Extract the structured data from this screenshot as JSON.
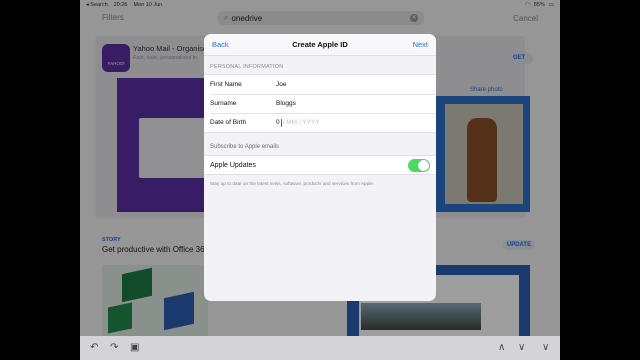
{
  "status": {
    "carrier": "◂ Search",
    "time": "20:26",
    "date": "Mon 10 Jun",
    "battery": "85%"
  },
  "search": {
    "filters_label": "Filters",
    "query": "onedrive",
    "cancel_label": "Cancel"
  },
  "background": {
    "app_name": "Yahoo Mail - Organise",
    "app_sub": "Fast, safe, personalised in",
    "app_icon_text": "YAHOO!",
    "get_label": "GET",
    "share_label": "Share photo",
    "story_tag": "STORY",
    "story_title": "Get productive with Office 365",
    "update_label": "UPDATE"
  },
  "modal": {
    "back_label": "Back",
    "title": "Create Apple ID",
    "next_label": "Next",
    "personal_header": "PERSONAL INFORMATION",
    "fields": [
      {
        "label": "First Name",
        "value": "Joe"
      },
      {
        "label": "Surname",
        "value": "Bloggs"
      }
    ],
    "dob_label": "Date of Birth",
    "dob_typed": "0",
    "dob_placeholder": " / MM / YYYY",
    "subscribe_header": "Subscribe to Apple emails",
    "updates_label": "Apple Updates",
    "updates_on": true,
    "updates_note": "Stay up to date on the latest news, software, products and services from Apple."
  },
  "colors": {
    "accent": "#2a6fd6",
    "toggle_on": "#4cd964"
  }
}
